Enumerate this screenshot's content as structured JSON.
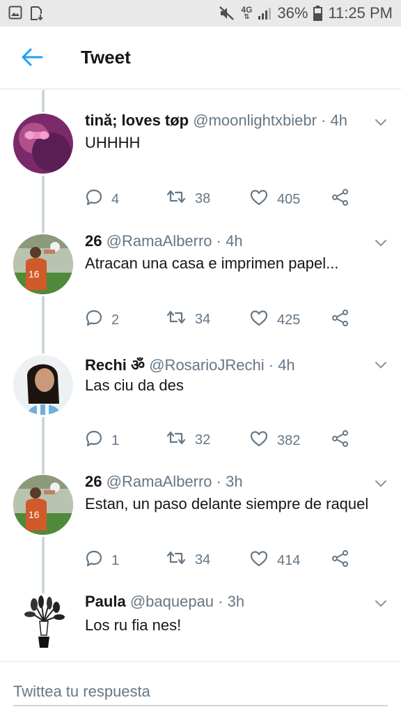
{
  "status_bar": {
    "network": "4G",
    "battery": "36%",
    "time": "11:25 PM"
  },
  "header": {
    "title": "Tweet"
  },
  "tweets": [
    {
      "name": "tinǎ; loves tøp",
      "handle": "@moonlightxbiebr",
      "separator": "·",
      "time": "4h",
      "text": "UHHHH",
      "replies": "4",
      "retweets": "38",
      "likes": "405"
    },
    {
      "name": "26",
      "handle": "@RamaAlberro",
      "separator": "·",
      "time": "4h",
      "text": "Atracan una casa e imprimen papel...",
      "replies": "2",
      "retweets": "34",
      "likes": "425"
    },
    {
      "name": "Rechi ॐ",
      "handle": "@RosarioJRechi",
      "separator": "·",
      "time": "4h",
      "text": "Las ciu da des",
      "replies": "1",
      "retweets": "32",
      "likes": "382"
    },
    {
      "name": "26",
      "handle": "@RamaAlberro",
      "separator": "·",
      "time": "3h",
      "text": "Estan, un paso delante siempre de raquel",
      "replies": "1",
      "retweets": "34",
      "likes": "414"
    },
    {
      "name": "Paula",
      "handle": "@baquepau",
      "separator": "·",
      "time": "3h",
      "text": "Los ru fia nes!"
    }
  ],
  "reply_bar": {
    "placeholder": "Twittea tu respuesta"
  },
  "colors": {
    "accent": "#1da1f2",
    "muted": "#657786",
    "text": "#14171a",
    "thread_line": "#ccd6dd"
  },
  "icons": {
    "back": "arrow-left-icon",
    "reply": "speech-bubble-icon",
    "retweet": "retweet-icon",
    "like": "heart-icon",
    "share": "share-icon",
    "more": "chevron-down-icon"
  }
}
